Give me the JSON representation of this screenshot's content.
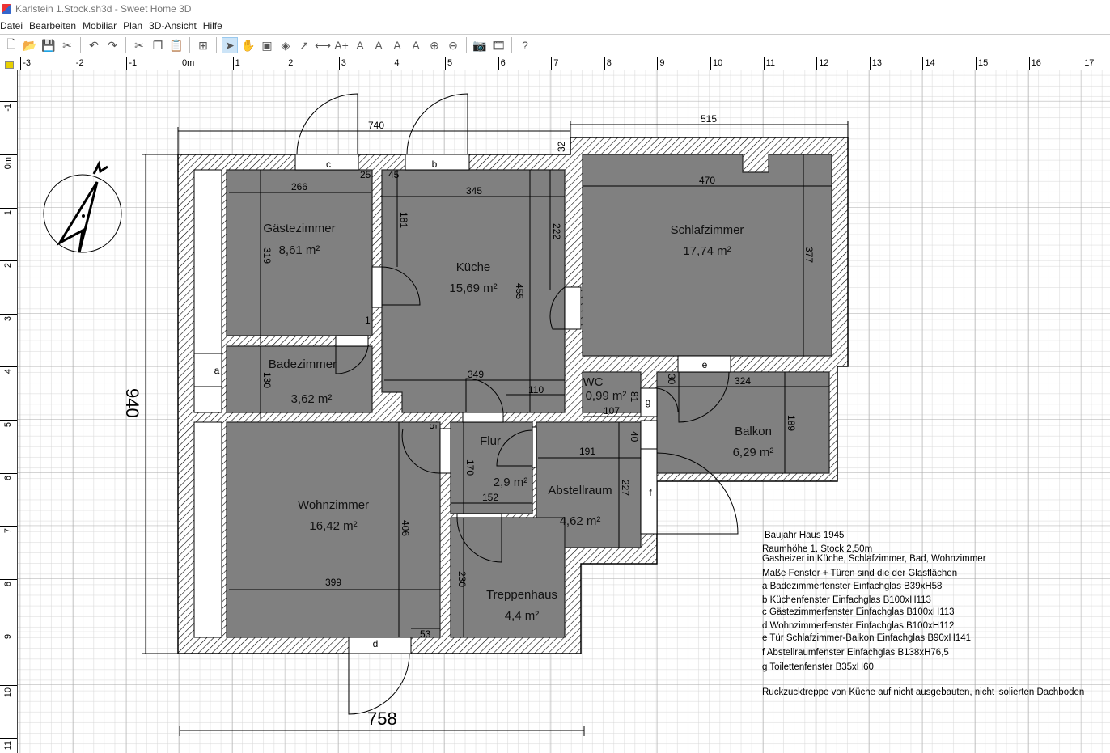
{
  "window": {
    "title": "Karlstein 1.Stock.sh3d - Sweet Home 3D"
  },
  "menu": [
    "Datei",
    "Bearbeiten",
    "Mobiliar",
    "Plan",
    "3D-Ansicht",
    "Hilfe"
  ],
  "toolbar": {
    "icons": [
      "new-file-icon",
      "open-icon",
      "save-icon",
      "preferences-icon",
      "undo-icon",
      "redo-icon",
      "cut-icon",
      "copy-icon",
      "paste-icon",
      "add-furniture-icon",
      "select-icon",
      "pan-icon",
      "create-walls-icon",
      "create-rooms-icon",
      "create-polylines-icon",
      "create-dimensions-icon",
      "add-text-icon",
      "increase-text-icon",
      "decrease-text-icon",
      "bold-icon",
      "italic-icon",
      "zoom-in-icon",
      "zoom-out-icon",
      "create-photo-icon",
      "create-video-icon",
      "help-icon"
    ],
    "glyphs": [
      "🗋",
      "📂",
      "💾",
      "✂",
      "↶",
      "↷",
      "✂",
      "❐",
      "📋",
      "⊞",
      "➤",
      "✋",
      "▣",
      "◈",
      "↗",
      "⟷",
      "A+",
      "A",
      "A",
      "A",
      "A",
      "⊕",
      "⊖",
      "📷",
      "🎞",
      "?"
    ]
  },
  "rulers": {
    "horizontal": [
      "-3",
      "-2",
      "-1",
      "0m",
      "1",
      "2",
      "3",
      "4",
      "5",
      "6",
      "7",
      "8",
      "9",
      "10",
      "11",
      "12",
      "13",
      "14",
      "15",
      "16",
      "17"
    ],
    "vertical": [
      "-1",
      "0m",
      "1",
      "2",
      "3",
      "4",
      "5",
      "6",
      "7",
      "8",
      "9",
      "10",
      "11"
    ]
  },
  "rooms": [
    {
      "name": "Gästezimmer",
      "area": "8,61 m²"
    },
    {
      "name": "Küche",
      "area": "15,69 m²"
    },
    {
      "name": "Schlafzimmer",
      "area": "17,74 m²"
    },
    {
      "name": "Badezimmer",
      "area": "3,62 m²"
    },
    {
      "name": "WC",
      "area": "0,99 m²"
    },
    {
      "name": "Balkon",
      "area": "6,29 m²"
    },
    {
      "name": "Wohnzimmer",
      "area": "16,42 m²"
    },
    {
      "name": "Flur",
      "area": "2,9 m²"
    },
    {
      "name": "Abstellraum",
      "area": "4,62 m²"
    },
    {
      "name": "Treppenhaus",
      "area": "4,4 m²"
    }
  ],
  "openings": [
    "a",
    "b",
    "c",
    "d",
    "e",
    "f",
    "g"
  ],
  "dimensions": [
    "740",
    "515",
    "32",
    "266",
    "25",
    "45",
    "345",
    "470",
    "181",
    "222",
    "319",
    "455",
    "377",
    "1",
    "349",
    "110",
    "130",
    "30",
    "324",
    "81",
    "107",
    "189",
    "191",
    "40",
    "170",
    "152",
    "227",
    "406",
    "399",
    "230",
    "53",
    "5",
    "940",
    "758"
  ],
  "notes": [
    "Baujahr Haus 1945",
    "Raumhöhe 1. Stock 2,50m",
    "Gasheizer in Küche, Schlafzimmer, Bad, Wohnzimmer",
    "Maße Fenster + Türen sind die der Glasflächen",
    "a Badezimmerfenster Einfachglas B39xH58",
    "b Küchenfenster Einfachglas B100xH113",
    "c Gästezimmerfenster Einfachglas B100xH113",
    "d Wohnzimmerfenster Einfachglas B100xH112",
    "e Tür Schlafzimmer-Balkon Einfachglas B90xH141",
    "f Abstellraumfenster Einfachglas B138xH76,5",
    "g Toilettenfenster B35xH60",
    "Ruckzucktreppe von Küche auf nicht ausgebauten, nicht isolierten Dachboden"
  ]
}
